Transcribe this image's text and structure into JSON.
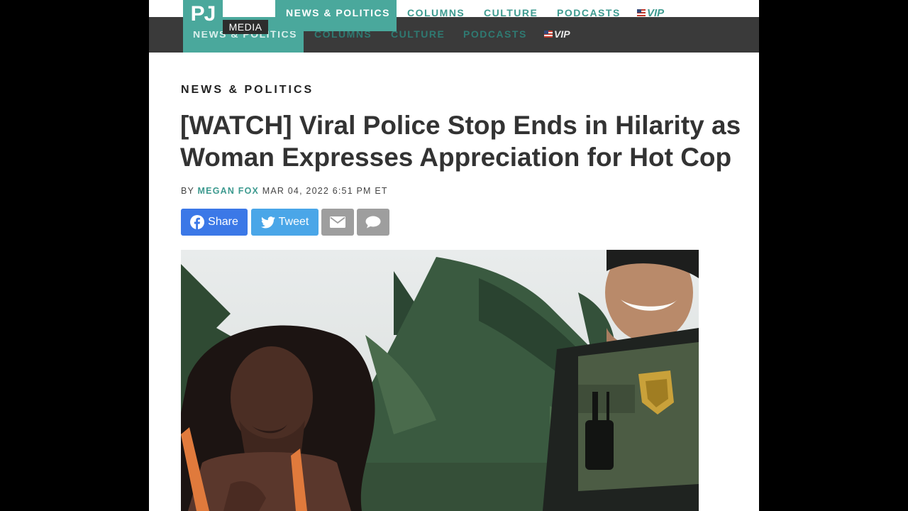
{
  "site": {
    "logo_main": "PJ",
    "logo_sub": "MEDIA"
  },
  "nav": {
    "items": [
      {
        "label": "NEWS & POLITICS",
        "active": true
      },
      {
        "label": "COLUMNS",
        "active": false
      },
      {
        "label": "CULTURE",
        "active": false
      },
      {
        "label": "PODCASTS",
        "active": false
      },
      {
        "label": "VIP",
        "active": false
      }
    ]
  },
  "ghost_nav": {
    "items": [
      "NEWS & POLITICS",
      "COLUMNS",
      "CULTURE",
      "PODCASTS",
      "VIP"
    ]
  },
  "article": {
    "category": "NEWS & POLITICS",
    "headline": "[WATCH] Viral Police Stop Ends in Hilarity as Woman Expresses Appreciation for Hot Cop",
    "by_label": "BY",
    "author": "MEGAN FOX",
    "date": "MAR 04, 2022 6:51 PM ET"
  },
  "share": {
    "facebook_label": "Share",
    "twitter_label": "Tweet"
  },
  "colors": {
    "brand_teal": "#4aa89c",
    "facebook": "#3b78e7",
    "twitter": "#4aa6e8"
  }
}
